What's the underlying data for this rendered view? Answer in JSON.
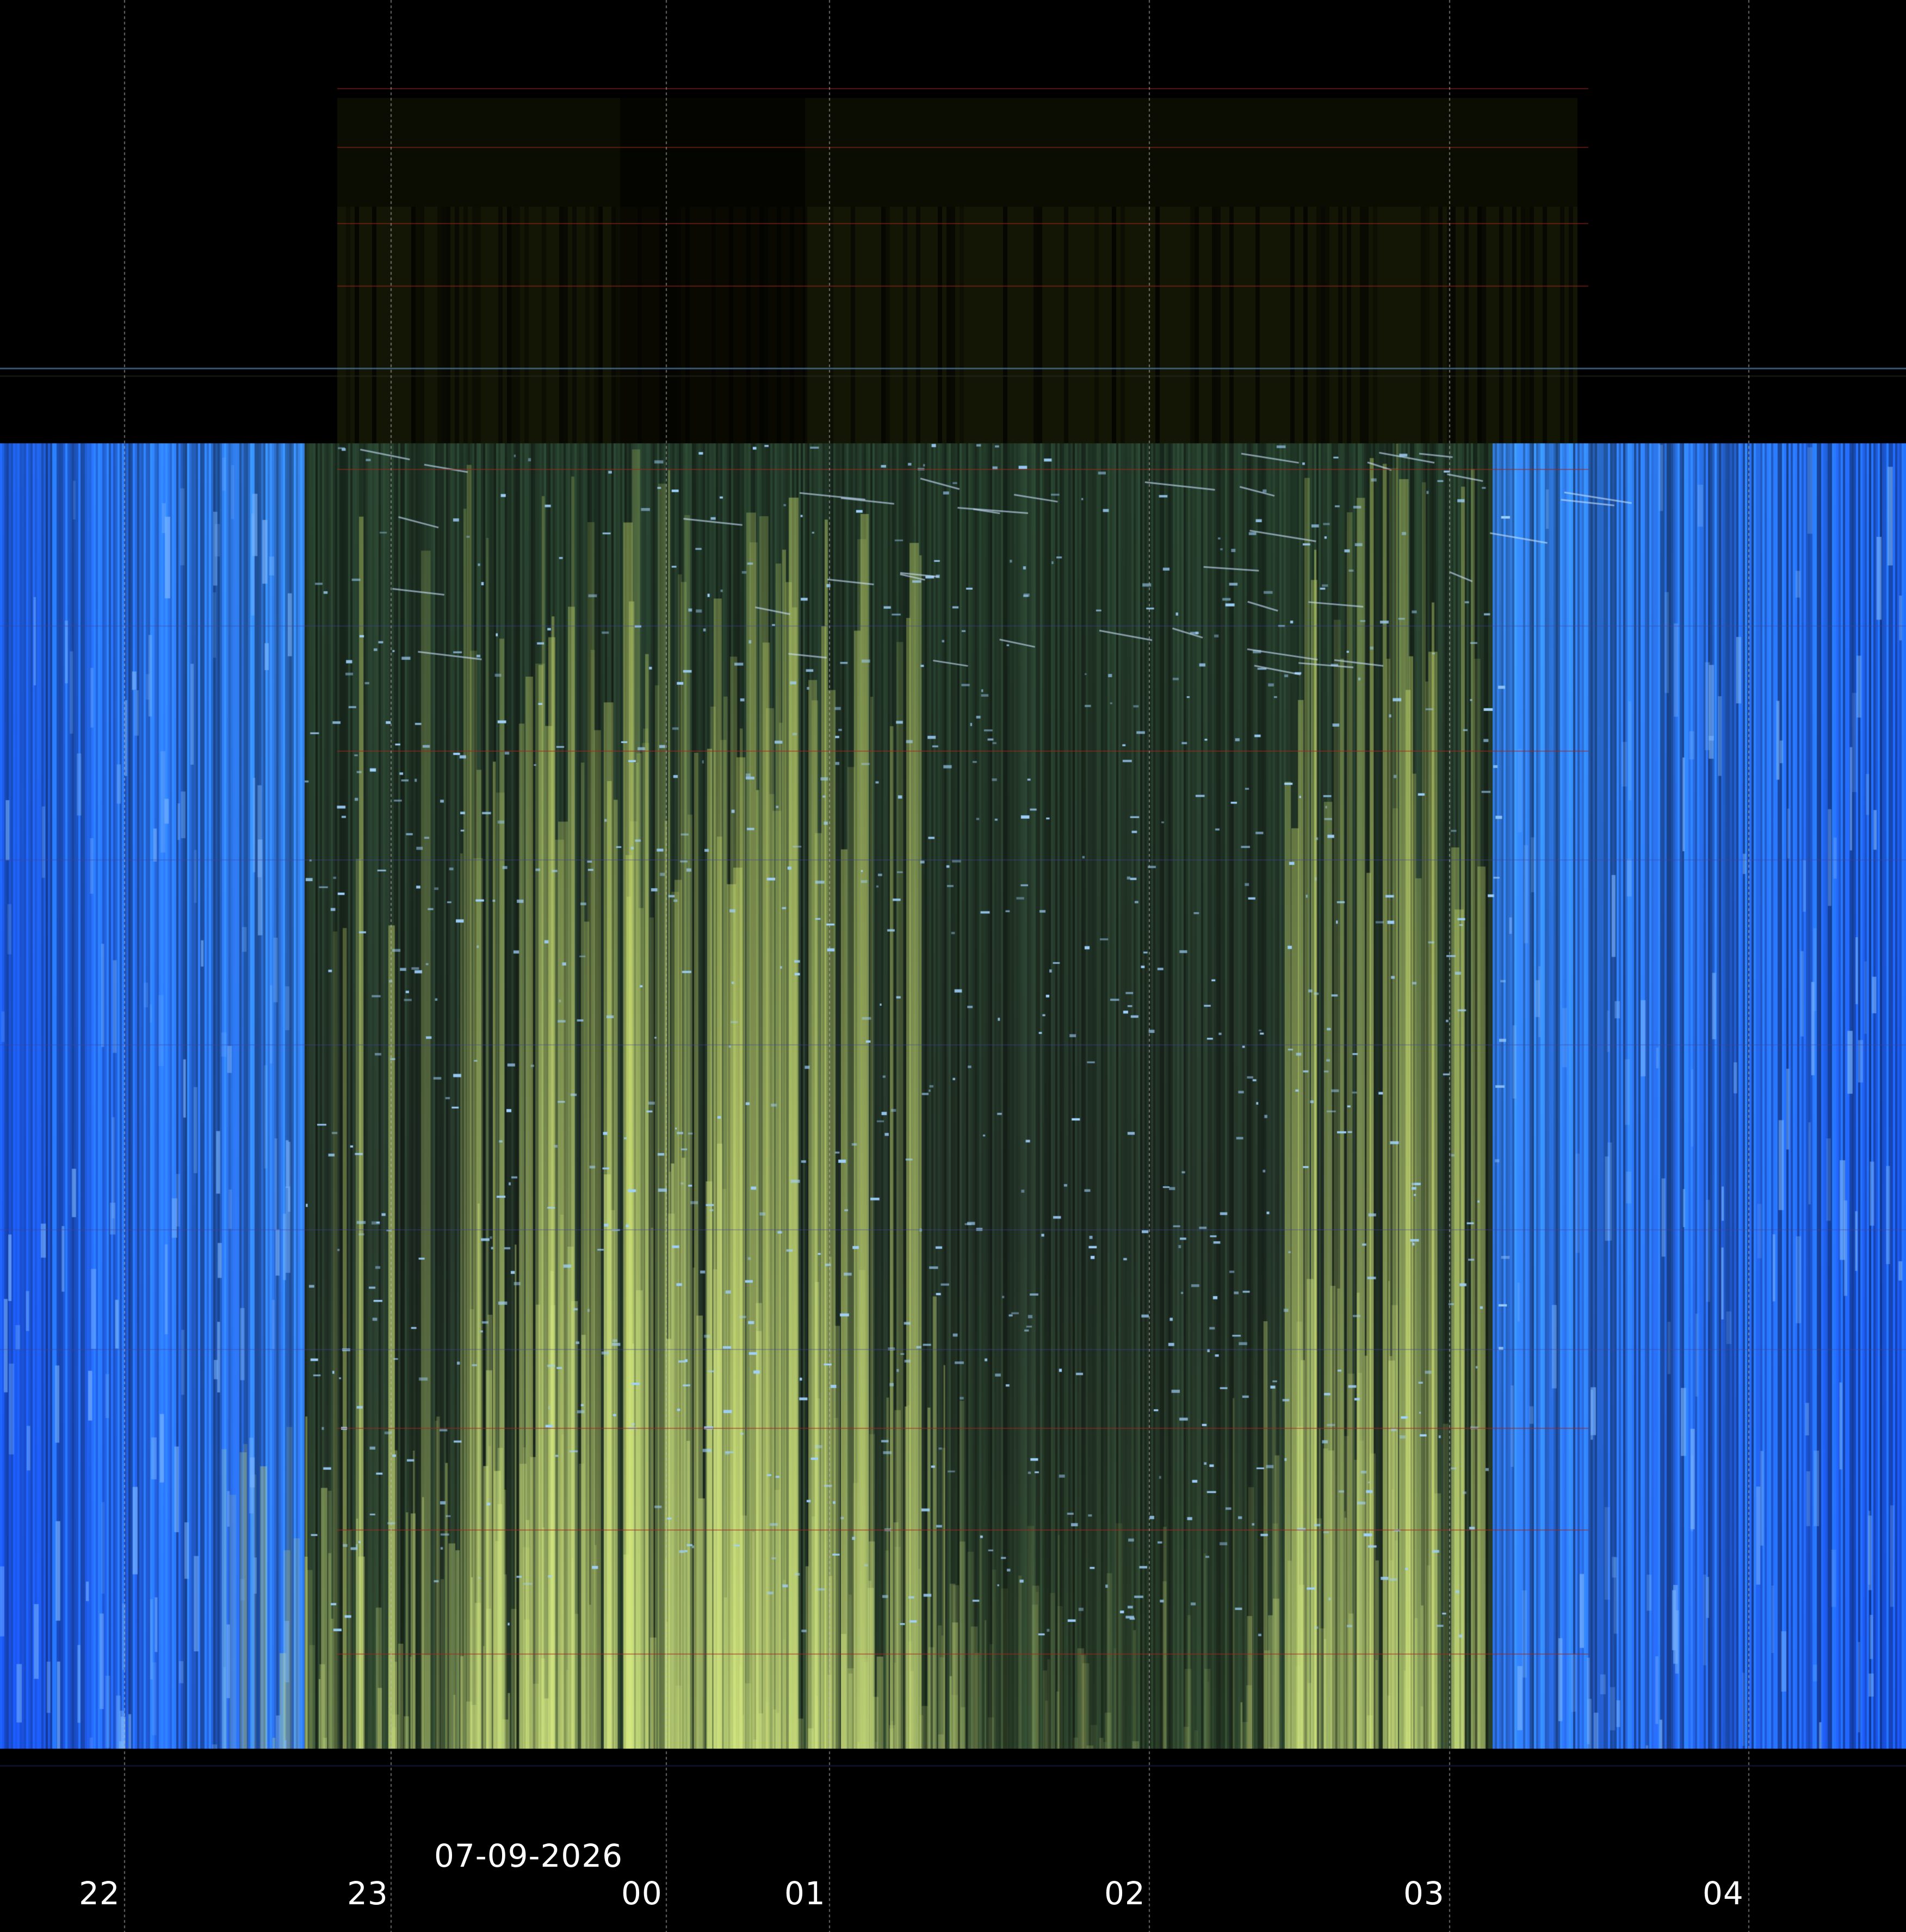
{
  "image": {
    "description_colors": {
      "night_sky_blue": "#2f6fc4",
      "twilight_blue": "#4a8fe0",
      "aurora_yellow_green": "#d6e68a",
      "background": "#000000",
      "gridline": "#9a9a9a",
      "label": "#ffffff"
    }
  },
  "axis": {
    "date": "07-09-2026",
    "hours": [
      {
        "label": "22"
      },
      {
        "label": "23"
      },
      {
        "label": "00"
      },
      {
        "label": "01"
      },
      {
        "label": "02"
      },
      {
        "label": "03"
      },
      {
        "label": "04"
      }
    ]
  }
}
